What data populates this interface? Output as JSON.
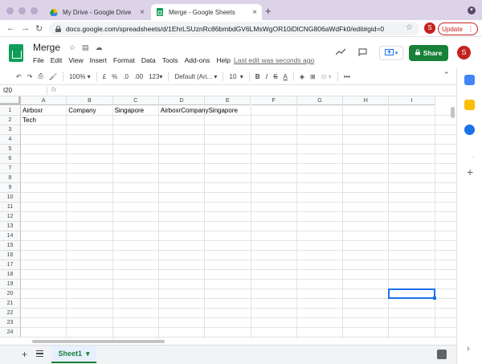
{
  "browser": {
    "tabs": [
      {
        "title": "My Drive - Google Drive",
        "icon": "google-drive-icon",
        "active": false
      },
      {
        "title": "Merge - Google Sheets",
        "icon": "google-sheets-icon",
        "active": true
      }
    ],
    "url": "docs.google.com/spreadsheets/d/1EhrLSUznRc86bmbdGV6LMsWgOR10iDlCNG806aWdFk0/edit#gid=0",
    "profile_letter": "S",
    "update_label": "Update"
  },
  "doc": {
    "title": "Merge",
    "menus": [
      "File",
      "Edit",
      "View",
      "Insert",
      "Format",
      "Data",
      "Tools",
      "Add-ons",
      "Help"
    ],
    "last_edit": "Last edit was seconds ago",
    "share_label": "Share",
    "user_letter": "S"
  },
  "toolbar": {
    "zoom": "100%",
    "currency": "£",
    "percent": "%",
    "dec_less": ".0",
    "dec_more": ".00",
    "number_format": "123",
    "font": "Default (Ari...",
    "font_size": "10",
    "bold": "B",
    "strike": "S",
    "text_color": "A"
  },
  "formula_bar": {
    "name_box": "I20",
    "fx": "fx",
    "value": ""
  },
  "grid": {
    "columns": [
      "A",
      "B",
      "C",
      "D",
      "E",
      "F",
      "G",
      "H",
      "I"
    ],
    "rows": [
      "1",
      "2",
      "3",
      "4",
      "5",
      "6",
      "7",
      "8",
      "9",
      "10",
      "11",
      "12",
      "13",
      "14",
      "15",
      "16",
      "17",
      "18",
      "19",
      "20",
      "21",
      "22",
      "23",
      "24"
    ],
    "cells": {
      "A1": "Airboxr",
      "B1": "Company",
      "C1": "Singapore",
      "D1": "AirboxrCompanySingapore",
      "A2": "Tech"
    },
    "selected": "I20"
  },
  "sheets": [
    {
      "name": "Sheet1",
      "active": true
    }
  ],
  "colors": {
    "sheets_green": "#188038",
    "selection_blue": "#1a73e8",
    "chrome_frame": "#dcd3e8"
  }
}
